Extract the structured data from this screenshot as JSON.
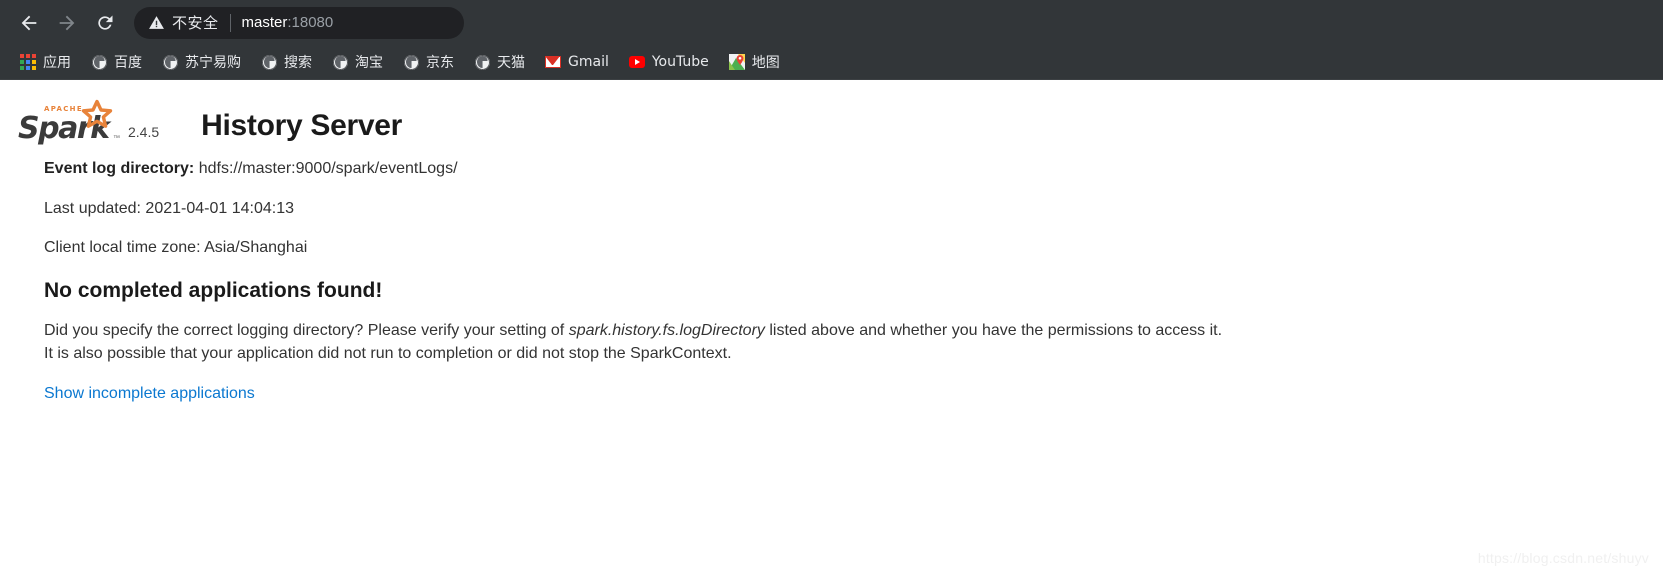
{
  "browser": {
    "nav": {
      "back_icon": "arrow-left-icon",
      "forward_icon": "arrow-right-icon",
      "reload_icon": "reload-icon"
    },
    "omnibox": {
      "security_icon": "warning-triangle-icon",
      "security_label": "不安全",
      "url_host": "master",
      "url_port": ":18080"
    },
    "bookmarks": [
      {
        "label": "应用",
        "icon": "apps-grid-icon"
      },
      {
        "label": "百度",
        "icon": "globe-icon"
      },
      {
        "label": "苏宁易购",
        "icon": "globe-icon"
      },
      {
        "label": "搜索",
        "icon": "globe-icon"
      },
      {
        "label": "淘宝",
        "icon": "globe-icon"
      },
      {
        "label": "京东",
        "icon": "globe-icon"
      },
      {
        "label": "天猫",
        "icon": "globe-icon"
      },
      {
        "label": "Gmail",
        "icon": "gmail-envelope-icon"
      },
      {
        "label": "YouTube",
        "icon": "youtube-play-icon"
      },
      {
        "label": "地图",
        "icon": "google-maps-pin-icon"
      }
    ]
  },
  "page": {
    "logo": {
      "apache_text": "APACHE",
      "spark_text": "Spark",
      "trademark": "™",
      "version": "2.4.5"
    },
    "title": "History Server",
    "event_log_label": "Event log directory:",
    "event_log_value": "hdfs://master:9000/spark/eventLogs/",
    "last_updated": "Last updated: 2021-04-01 14:04:13",
    "time_zone": "Client local time zone: Asia/Shanghai",
    "no_apps_heading": "No completed applications found!",
    "explain_line1_a": "Did you specify the correct logging directory? Please verify your setting of ",
    "explain_line1_em": "spark.history.fs.logDirectory",
    "explain_line1_b": " listed above and whether you have the permissions to access it.",
    "explain_line2": "It is also possible that your application did not run to completion or did not stop the SparkContext.",
    "show_incomplete_link": "Show incomplete applications",
    "watermark": "https://blog.csdn.net/shuyv"
  },
  "colors": {
    "chrome_bg": "#323639",
    "omnibox_bg": "#202124",
    "link_blue": "#0b78d0",
    "spark_orange": "#e8833a"
  }
}
